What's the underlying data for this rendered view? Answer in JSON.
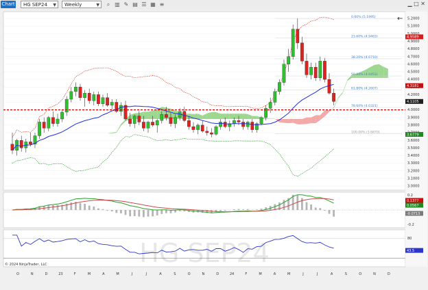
{
  "toolbar": {
    "chart_tab": "Chart",
    "instrument": "HG SEP24",
    "period": "Weekly",
    "icons": [
      "magnifier-icon",
      "bar-style-icon",
      "draw-icon",
      "template-icon",
      "properties-icon",
      "calendar-icon",
      "menu-icon"
    ]
  },
  "watermark": "HG SEP24",
  "copyright": "© 2024 NinjaTrader, LLC",
  "colors": {
    "up_candle": "#2fbf2f",
    "down_candle": "#d9241f",
    "kijun_blue": "#1f2fd6",
    "horizontal_red": "#d40000",
    "cloud_green": "#7ecb6b",
    "cloud_red": "#f08c8c",
    "fib_blue": "#3a7fd8",
    "bollinger_red": "#d83a2a",
    "bollinger_green": "#2a9a2a",
    "macd_green": "#2aa02a",
    "macd_red": "#c84b4b",
    "rsi_line": "#2b36c8"
  },
  "x_axis_labels": [
    "O",
    "N",
    "D",
    "23",
    "F",
    "M",
    "A",
    "M",
    "J",
    "J",
    "A",
    "S",
    "O",
    "N",
    "D",
    "24",
    "F",
    "M",
    "A",
    "M",
    "J",
    "J",
    "A",
    "S",
    "O",
    "N",
    "D"
  ],
  "price_axis_labels": [
    "5.2000",
    "5.1000",
    "5.0000",
    "4.9000",
    "4.8000",
    "4.7000",
    "4.6000",
    "4.5000",
    "4.4000",
    "4.3000",
    "4.2000",
    "4.1000",
    "4.0000",
    "3.9000",
    "3.8000",
    "3.7000",
    "3.6000",
    "3.5000",
    "3.4000",
    "3.3000",
    "3.2000",
    "3.1000",
    "3.0000"
  ],
  "price_tags": {
    "upper": "4.9589",
    "mid": "4.3181",
    "last": "4.1105",
    "lower": "3.6779"
  },
  "fib_levels": [
    {
      "label": "0.00% (5.1995)",
      "price": 5.1995
    },
    {
      "label": "23.60% (4.9463)",
      "price": 4.9463
    },
    {
      "label": "38.20% (4.6710)",
      "price": 4.671
    },
    {
      "label": "50.00% (4.4453)",
      "price": 4.4453
    },
    {
      "label": "61.80% (4.2607)",
      "price": 4.2607
    },
    {
      "label": "78.60% (4.0321)",
      "price": 4.0321
    },
    {
      "label": "100.00% (3.6870)",
      "price": 3.687
    }
  ],
  "macd_axis": [
    "0.2",
    "-0.2"
  ],
  "macd_tags": {
    "macd": "0.1377",
    "signal": "0.0567",
    "diff": "-0.0713"
  },
  "rsi_axis": [
    "80"
  ],
  "rsi_tag": "43.5",
  "chart_data": {
    "type": "candlestick",
    "instrument": "HG SEP24",
    "period": "Weekly",
    "price_range": [
      3.0,
      5.25
    ],
    "horizontal_line": 4.0,
    "candles": [
      {
        "o": 3.55,
        "h": 3.7,
        "l": 3.42,
        "c": 3.47
      },
      {
        "o": 3.47,
        "h": 3.62,
        "l": 3.4,
        "c": 3.6
      },
      {
        "o": 3.6,
        "h": 3.66,
        "l": 3.45,
        "c": 3.5
      },
      {
        "o": 3.5,
        "h": 3.62,
        "l": 3.44,
        "c": 3.58
      },
      {
        "o": 3.58,
        "h": 3.7,
        "l": 3.52,
        "c": 3.55
      },
      {
        "o": 3.55,
        "h": 3.7,
        "l": 3.5,
        "c": 3.66
      },
      {
        "o": 3.66,
        "h": 3.88,
        "l": 3.62,
        "c": 3.84
      },
      {
        "o": 3.84,
        "h": 3.9,
        "l": 3.7,
        "c": 3.76
      },
      {
        "o": 3.76,
        "h": 3.92,
        "l": 3.72,
        "c": 3.9
      },
      {
        "o": 3.9,
        "h": 3.98,
        "l": 3.78,
        "c": 3.82
      },
      {
        "o": 3.82,
        "h": 3.95,
        "l": 3.78,
        "c": 3.88
      },
      {
        "o": 3.88,
        "h": 4.0,
        "l": 3.84,
        "c": 3.97
      },
      {
        "o": 3.97,
        "h": 4.18,
        "l": 3.92,
        "c": 4.14
      },
      {
        "o": 4.14,
        "h": 4.3,
        "l": 4.1,
        "c": 4.24
      },
      {
        "o": 4.24,
        "h": 4.36,
        "l": 4.18,
        "c": 4.3
      },
      {
        "o": 4.3,
        "h": 4.34,
        "l": 4.12,
        "c": 4.16
      },
      {
        "o": 4.16,
        "h": 4.26,
        "l": 4.04,
        "c": 4.22
      },
      {
        "o": 4.22,
        "h": 4.28,
        "l": 4.08,
        "c": 4.12
      },
      {
        "o": 4.12,
        "h": 4.24,
        "l": 4.06,
        "c": 4.2
      },
      {
        "o": 4.2,
        "h": 4.24,
        "l": 4.05,
        "c": 4.08
      },
      {
        "o": 4.08,
        "h": 4.2,
        "l": 4.04,
        "c": 4.16
      },
      {
        "o": 4.16,
        "h": 4.22,
        "l": 4.04,
        "c": 4.06
      },
      {
        "o": 4.06,
        "h": 4.14,
        "l": 4.0,
        "c": 4.1
      },
      {
        "o": 4.1,
        "h": 4.14,
        "l": 3.96,
        "c": 3.98
      },
      {
        "o": 3.98,
        "h": 4.1,
        "l": 3.92,
        "c": 4.06
      },
      {
        "o": 4.06,
        "h": 4.12,
        "l": 3.86,
        "c": 3.88
      },
      {
        "o": 3.88,
        "h": 3.96,
        "l": 3.78,
        "c": 3.82
      },
      {
        "o": 3.82,
        "h": 3.94,
        "l": 3.76,
        "c": 3.92
      },
      {
        "o": 3.92,
        "h": 3.98,
        "l": 3.8,
        "c": 3.84
      },
      {
        "o": 3.84,
        "h": 3.92,
        "l": 3.72,
        "c": 3.76
      },
      {
        "o": 3.76,
        "h": 3.86,
        "l": 3.7,
        "c": 3.84
      },
      {
        "o": 3.84,
        "h": 3.92,
        "l": 3.78,
        "c": 3.8
      },
      {
        "o": 3.8,
        "h": 3.88,
        "l": 3.7,
        "c": 3.86
      },
      {
        "o": 3.86,
        "h": 3.98,
        "l": 3.82,
        "c": 3.94
      },
      {
        "o": 3.94,
        "h": 4.04,
        "l": 3.86,
        "c": 3.9
      },
      {
        "o": 3.9,
        "h": 3.96,
        "l": 3.78,
        "c": 3.82
      },
      {
        "o": 3.82,
        "h": 3.94,
        "l": 3.76,
        "c": 3.9
      },
      {
        "o": 3.9,
        "h": 4.02,
        "l": 3.86,
        "c": 3.98
      },
      {
        "o": 3.98,
        "h": 4.04,
        "l": 3.84,
        "c": 3.86
      },
      {
        "o": 3.86,
        "h": 3.92,
        "l": 3.74,
        "c": 3.78
      },
      {
        "o": 3.78,
        "h": 3.84,
        "l": 3.7,
        "c": 3.74
      },
      {
        "o": 3.74,
        "h": 3.82,
        "l": 3.68,
        "c": 3.8
      },
      {
        "o": 3.8,
        "h": 3.86,
        "l": 3.7,
        "c": 3.72
      },
      {
        "o": 3.72,
        "h": 3.78,
        "l": 3.66,
        "c": 3.7
      },
      {
        "o": 3.7,
        "h": 3.76,
        "l": 3.64,
        "c": 3.68
      },
      {
        "o": 3.68,
        "h": 3.8,
        "l": 3.66,
        "c": 3.78
      },
      {
        "o": 3.78,
        "h": 3.88,
        "l": 3.74,
        "c": 3.84
      },
      {
        "o": 3.84,
        "h": 3.9,
        "l": 3.76,
        "c": 3.78
      },
      {
        "o": 3.78,
        "h": 3.86,
        "l": 3.72,
        "c": 3.82
      },
      {
        "o": 3.82,
        "h": 3.9,
        "l": 3.78,
        "c": 3.86
      },
      {
        "o": 3.86,
        "h": 3.92,
        "l": 3.8,
        "c": 3.84
      },
      {
        "o": 3.84,
        "h": 3.88,
        "l": 3.74,
        "c": 3.78
      },
      {
        "o": 3.78,
        "h": 3.86,
        "l": 3.74,
        "c": 3.84
      },
      {
        "o": 3.84,
        "h": 3.88,
        "l": 3.7,
        "c": 3.74
      },
      {
        "o": 3.74,
        "h": 3.84,
        "l": 3.7,
        "c": 3.82
      },
      {
        "o": 3.82,
        "h": 3.92,
        "l": 3.8,
        "c": 3.9
      },
      {
        "o": 3.9,
        "h": 4.06,
        "l": 3.86,
        "c": 4.02
      },
      {
        "o": 4.02,
        "h": 4.16,
        "l": 3.96,
        "c": 4.1
      },
      {
        "o": 4.1,
        "h": 4.28,
        "l": 4.06,
        "c": 4.24
      },
      {
        "o": 4.24,
        "h": 4.4,
        "l": 4.2,
        "c": 4.36
      },
      {
        "o": 4.36,
        "h": 4.66,
        "l": 4.32,
        "c": 4.6
      },
      {
        "o": 4.6,
        "h": 4.8,
        "l": 4.5,
        "c": 4.7
      },
      {
        "o": 4.7,
        "h": 5.12,
        "l": 4.66,
        "c": 5.06
      },
      {
        "o": 5.06,
        "h": 5.2,
        "l": 4.8,
        "c": 4.88
      },
      {
        "o": 4.88,
        "h": 4.96,
        "l": 4.6,
        "c": 4.64
      },
      {
        "o": 4.64,
        "h": 4.74,
        "l": 4.42,
        "c": 4.46
      },
      {
        "o": 4.46,
        "h": 4.62,
        "l": 4.4,
        "c": 4.56
      },
      {
        "o": 4.56,
        "h": 4.62,
        "l": 4.38,
        "c": 4.42
      },
      {
        "o": 4.42,
        "h": 4.7,
        "l": 4.38,
        "c": 4.64
      },
      {
        "o": 4.64,
        "h": 4.68,
        "l": 4.36,
        "c": 4.4
      },
      {
        "o": 4.4,
        "h": 4.48,
        "l": 4.2,
        "c": 4.22
      },
      {
        "o": 4.22,
        "h": 4.28,
        "l": 4.06,
        "c": 4.11
      }
    ]
  }
}
